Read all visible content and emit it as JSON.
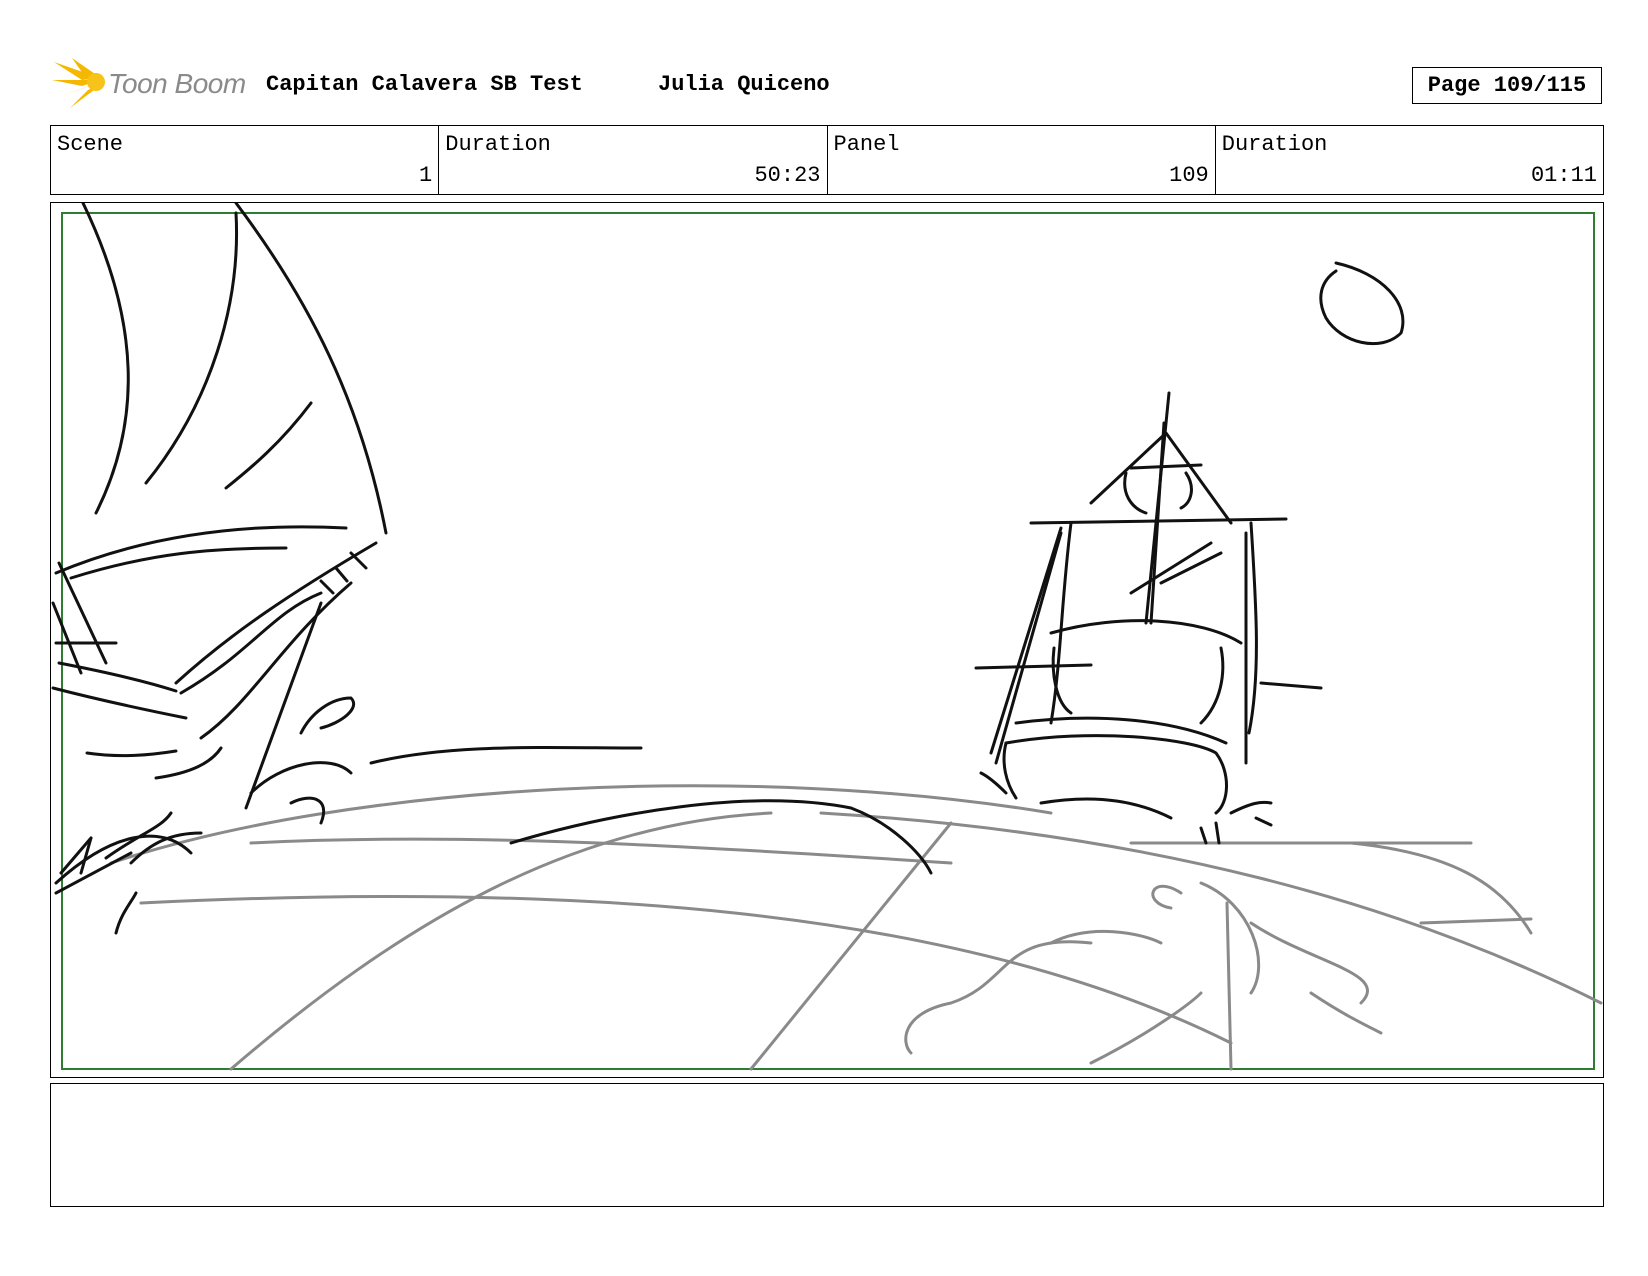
{
  "header": {
    "logo_text": "Toon Boom",
    "title": "Capitan Calavera SB Test",
    "author": "Julia Quiceno",
    "page_indicator": "Page 109/115"
  },
  "info": {
    "scene_label": "Scene",
    "scene_value": "1",
    "scene_duration_label": "Duration",
    "scene_duration_value": "50:23",
    "panel_label": "Panel",
    "panel_value": "109",
    "panel_duration_label": "Duration",
    "panel_duration_value": "01:11"
  },
  "notes": {
    "text": ""
  },
  "colors": {
    "safe_frame": "#2e7d32",
    "sketch_dark": "#111111",
    "sketch_grey": "#8a8a8a",
    "logo_yellow": "#f5b800"
  }
}
